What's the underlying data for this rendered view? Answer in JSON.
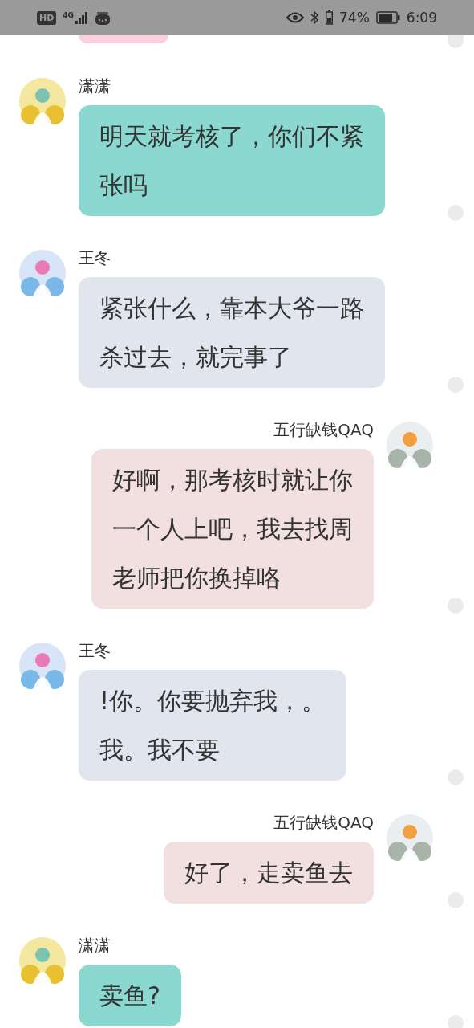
{
  "status_bar": {
    "network_badge": "HD",
    "network_type": "4G",
    "battery": "74%",
    "time": "6:09"
  },
  "messages": [
    {
      "kind": "incoming",
      "sender": "潇潇",
      "color": "#8ad8d0",
      "lines": [
        "明天就考核了，你们不紧",
        "张吗"
      ]
    },
    {
      "kind": "incoming",
      "sender": "王冬",
      "color": "#e1e6ee",
      "lines": [
        "紧张什么，靠本大爷一路",
        "杀过去，就完事了"
      ]
    },
    {
      "kind": "outgoing",
      "sender": "五行缺钱QAQ",
      "color": "#f2dfe0",
      "lines": [
        "好啊，那考核时就让你",
        "一个人上吧，我去找周",
        "老师把你换掉咯"
      ]
    },
    {
      "kind": "incoming",
      "sender": "王冬",
      "color": "#e1e6ee",
      "lines": [
        "!你。你要抛弃我，。",
        "我。我不要"
      ]
    },
    {
      "kind": "outgoing",
      "sender": "五行缺钱QAQ",
      "color": "#f2dfe0",
      "lines": [
        "好了，走卖鱼去"
      ]
    },
    {
      "kind": "incoming",
      "sender": "潇潇",
      "color": "#8ad8d0",
      "lines": [
        "卖鱼?"
      ]
    }
  ]
}
